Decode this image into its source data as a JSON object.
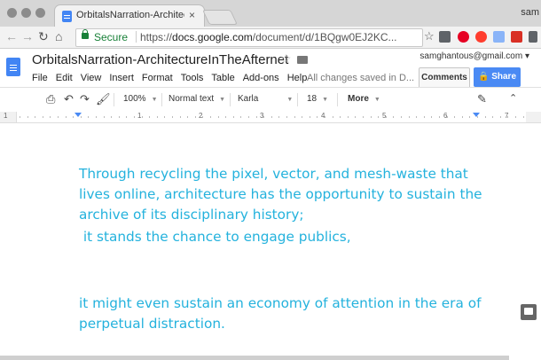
{
  "browser": {
    "tab_title": "OrbitalsNarration-Architecture",
    "tab_close": "×",
    "profile": "sam",
    "secure_label": "Secure",
    "url_prefix": "https://",
    "url_host": "docs.google.com",
    "url_path": "/document/d/1BQgw0EJ2KC..."
  },
  "docs": {
    "title": "OrbitalsNarration-ArchitectureInTheAfternet",
    "menu": [
      "File",
      "Edit",
      "View",
      "Insert",
      "Format",
      "Tools",
      "Table",
      "Add-ons",
      "Help"
    ],
    "saved_status": "All changes saved in D...",
    "account": "samghantous@gmail.com",
    "comments_label": "Comments",
    "share_label": "Share"
  },
  "format_toolbar": {
    "zoom": "100%",
    "style": "Normal text",
    "font": "Karla",
    "size": "18",
    "more": "More"
  },
  "ruler": {
    "numbers": [
      "1",
      "1",
      "2",
      "3",
      "4",
      "5",
      "6",
      "7"
    ]
  },
  "document": {
    "paragraphs": [
      "Through recycling the pixel, vector, and mesh-waste that lives online, architecture has the opportunity to sustain the archive of its disciplinary history;",
      " it stands the chance to engage publics,",
      "it might even sustain an economy of attention in the era of perpetual distraction."
    ],
    "text_color": "#24b2dd"
  }
}
